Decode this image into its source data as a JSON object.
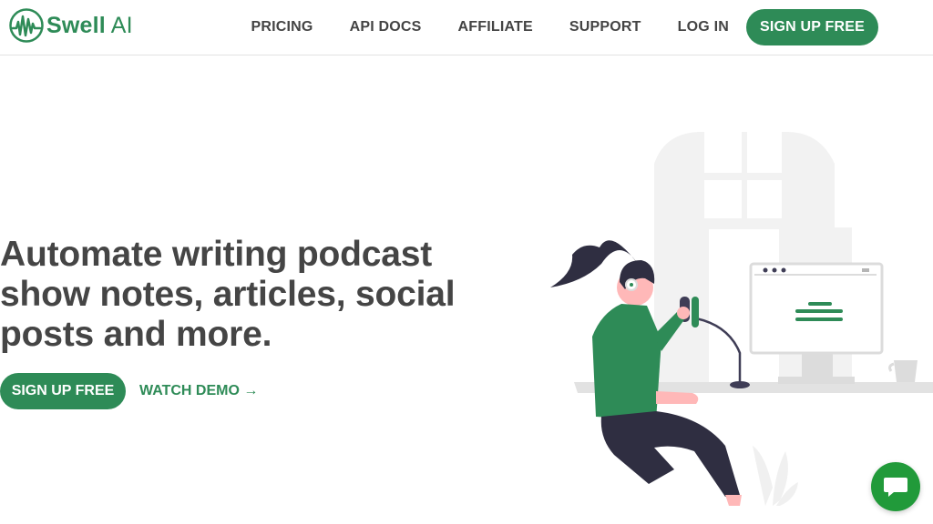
{
  "brand": {
    "name_bold": "Swell",
    "name_light": "AI",
    "color": "#2e8b57"
  },
  "nav": {
    "items": [
      {
        "label": "PRICING"
      },
      {
        "label": "API DOCS"
      },
      {
        "label": "AFFILIATE"
      },
      {
        "label": "SUPPORT"
      },
      {
        "label": "LOG IN"
      }
    ],
    "signup_label": "SIGN UP FREE"
  },
  "hero": {
    "title": "Automate writing podcast show notes, articles, social posts and more.",
    "primary_cta": "SIGN UP FREE",
    "secondary_cta": "WATCH DEMO →"
  },
  "icons": {
    "logo": "waveform-logo-icon",
    "chat": "chat-icon"
  },
  "colors": {
    "accent": "#2e8b57",
    "text": "#454545",
    "chat": "#219a3a"
  }
}
